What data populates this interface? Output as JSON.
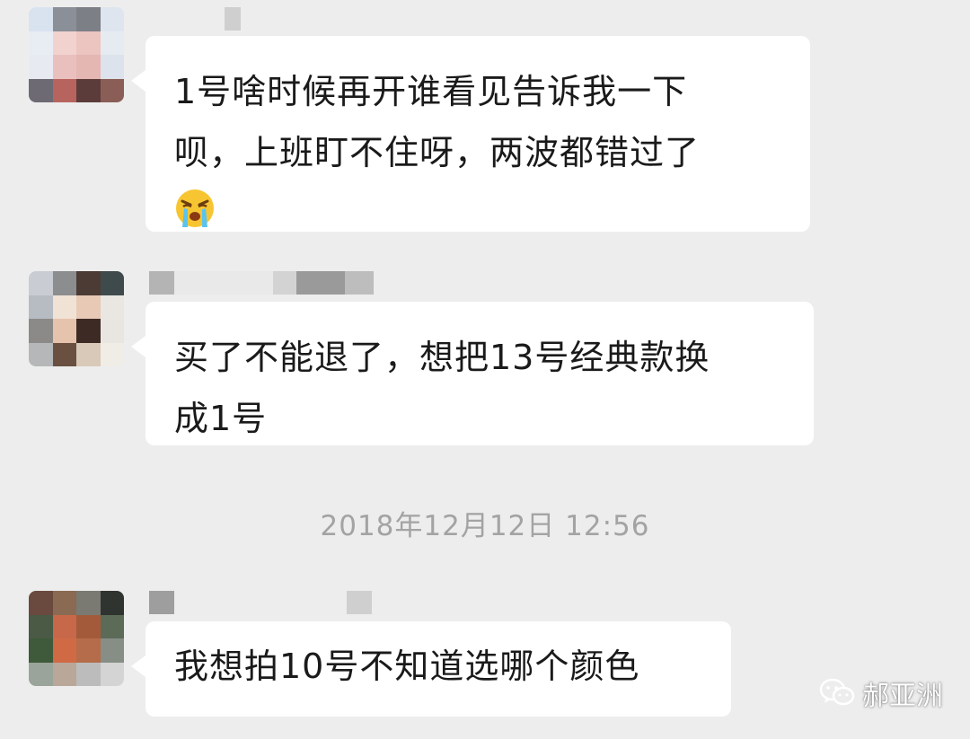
{
  "chat": {
    "messages": [
      {
        "sender": "redacted",
        "line1": "1号啥时候再开谁看见告诉我一下",
        "line2": "呗，上班盯不住呀，两波都错过了",
        "emoji": "loudly-crying-face"
      },
      {
        "sender": "redacted",
        "line1": "买了不能退了，想把13号经典款换",
        "line2": "成1号"
      },
      {
        "sender": "redacted",
        "line1": "我想拍10号不知道选哪个颜色"
      }
    ],
    "timestamp": "2018年12月12日 12:56"
  },
  "watermark": {
    "text": "郝亚洲",
    "icon": "wechat-icon"
  },
  "colors": {
    "background": "#ededed",
    "bubble": "#ffffff",
    "text": "#1a1a1a",
    "timestamp": "#a3a3a3"
  }
}
